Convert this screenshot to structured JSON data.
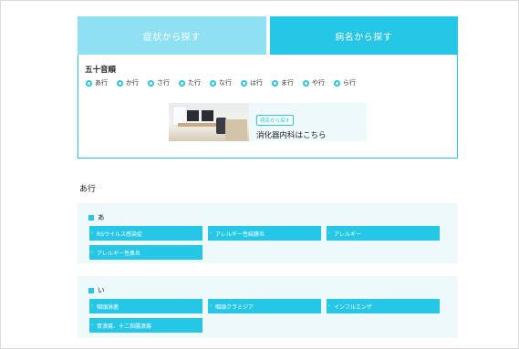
{
  "tabs": {
    "symptom": "症状から探す",
    "disease": "病名から探す"
  },
  "index": {
    "title": "五十音順",
    "rows": [
      "あ行",
      "か行",
      "さ行",
      "た行",
      "な行",
      "は行",
      "ま行",
      "や行",
      "ら行"
    ]
  },
  "banner": {
    "tag": "病名から探す",
    "label": "消化器内科はこちら"
  },
  "section": {
    "heading": "あ行",
    "groups": [
      {
        "letter": "あ",
        "items": [
          "RSウイルス感染症",
          "アレルギー性結膜炎",
          "アレルギー",
          "アレルギー性鼻炎"
        ]
      },
      {
        "letter": "い",
        "items": [
          "咽頭淋菌",
          "咽頭クラミジア",
          "インフルエンザ",
          "胃潰瘍、十二指腸潰瘍"
        ]
      }
    ]
  },
  "colors": {
    "accent": "#25c6e6",
    "accent_light": "#8fe0f2",
    "group_bg": "#eef9fb"
  }
}
